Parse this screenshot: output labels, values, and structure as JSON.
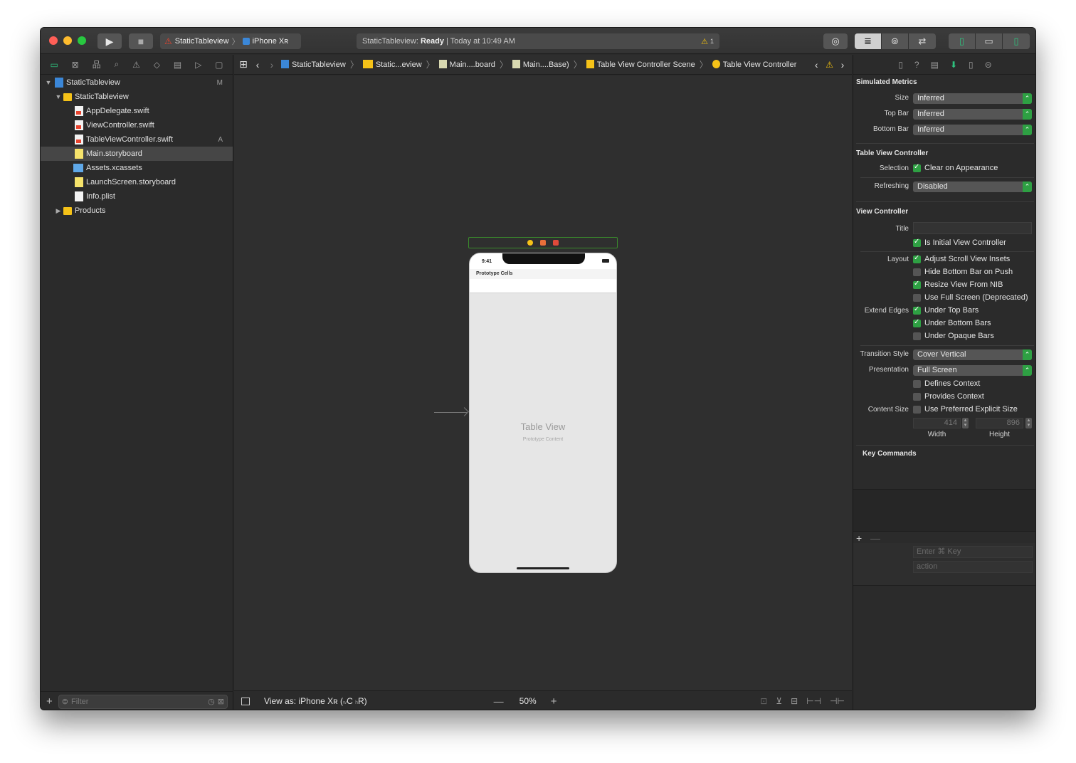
{
  "toolbar": {
    "scheme_name": "StaticTableview",
    "device_name": "iPhone Xʀ",
    "status_project": "StaticTableview:",
    "status_state": "Ready",
    "status_time": "| Today at 10:49 AM",
    "warning_count": "1"
  },
  "navigator": {
    "items": [
      {
        "label": "StaticTableview",
        "badge": "M"
      },
      {
        "label": "StaticTableview",
        "badge": ""
      },
      {
        "label": "AppDelegate.swift",
        "badge": ""
      },
      {
        "label": "ViewController.swift",
        "badge": ""
      },
      {
        "label": "TableViewController.swift",
        "badge": "A"
      },
      {
        "label": "Main.storyboard",
        "badge": ""
      },
      {
        "label": "Assets.xcassets",
        "badge": ""
      },
      {
        "label": "LaunchScreen.storyboard",
        "badge": ""
      },
      {
        "label": "Info.plist",
        "badge": ""
      },
      {
        "label": "Products",
        "badge": ""
      }
    ],
    "filter_placeholder": "Filter"
  },
  "jumpbar": {
    "crumbs": [
      "StaticTableview",
      "Static...eview",
      "Main....board",
      "Main....Base)",
      "Table View Controller Scene",
      "Table View Controller"
    ]
  },
  "canvas": {
    "status_time": "9:41",
    "prototype_cells": "Prototype Cells",
    "table_view_label": "Table View",
    "prototype_content": "Prototype Content"
  },
  "bottombar": {
    "view_as_prefix": "View as: iPhone Xʀ (",
    "w_size": "w",
    "w_class": "C",
    "h_size": "h",
    "h_class": "R",
    "view_as_suffix": ")",
    "zoom": "50%"
  },
  "inspector": {
    "simulated_metrics": {
      "title": "Simulated Metrics",
      "size_label": "Size",
      "size_value": "Inferred",
      "topbar_label": "Top Bar",
      "topbar_value": "Inferred",
      "bottombar_label": "Bottom Bar",
      "bottombar_value": "Inferred"
    },
    "table_view_controller": {
      "title": "Table View Controller",
      "selection_label": "Selection",
      "clear_on_appearance": "Clear on Appearance",
      "refreshing_label": "Refreshing",
      "refreshing_value": "Disabled"
    },
    "view_controller": {
      "title": "View Controller",
      "title_label": "Title",
      "is_initial": "Is Initial View Controller",
      "layout_label": "Layout",
      "adjust_insets": "Adjust Scroll View Insets",
      "hide_bottom_bar": "Hide Bottom Bar on Push",
      "resize_view": "Resize View From NIB",
      "use_full_screen": "Use Full Screen (Deprecated)",
      "extend_edges_label": "Extend Edges",
      "under_top": "Under Top Bars",
      "under_bottom": "Under Bottom Bars",
      "under_opaque": "Under Opaque Bars",
      "transition_label": "Transition Style",
      "transition_value": "Cover Vertical",
      "presentation_label": "Presentation",
      "presentation_value": "Full Screen",
      "defines_context": "Defines Context",
      "provides_context": "Provides Context",
      "content_size_label": "Content Size",
      "use_preferred": "Use Preferred Explicit Size",
      "width_value": "414",
      "height_value": "896",
      "width_label": "Width",
      "height_label": "Height"
    },
    "key_commands": {
      "title": "Key Commands",
      "key_placeholder": "Enter ⌘ Key",
      "action_placeholder": "action"
    }
  }
}
